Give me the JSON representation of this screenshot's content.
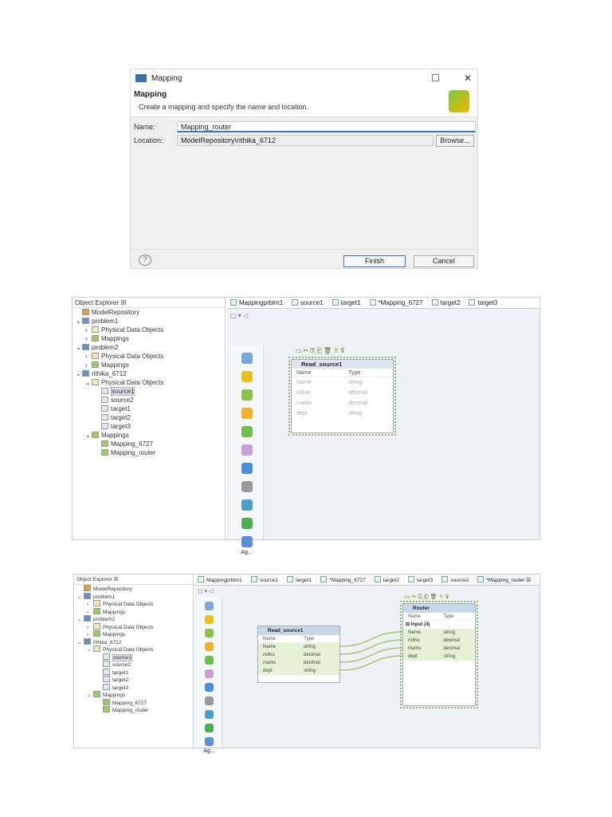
{
  "dialog": {
    "title": "Mapping",
    "heading": "Mapping",
    "description": "Create a mapping and specify the name and location.",
    "name_label": "Name:",
    "name_value": "Mapping_router",
    "location_label": "Location:",
    "location_value": "ModelRepository\\rithika_6712",
    "browse": "Browse...",
    "finish": "Finish",
    "cancel": "Cancel",
    "help_icon": "?",
    "maximize_icon": "☐",
    "close_icon": "✕"
  },
  "explorer": {
    "title": "Object Explorer ☒",
    "tree": [
      {
        "d": 0,
        "t": "ModelRepository",
        "i": "repo"
      },
      {
        "d": 0,
        "t": "problem1",
        "e": "v",
        "i": "project"
      },
      {
        "d": 1,
        "t": "Physical Data Objects",
        "e": ">",
        "i": "folder"
      },
      {
        "d": 1,
        "t": "Mappings",
        "e": ">",
        "i": "mapping"
      },
      {
        "d": 0,
        "t": "problem2",
        "e": "v",
        "i": "project"
      },
      {
        "d": 1,
        "t": "Physical Data Objects",
        "e": ">",
        "i": "folder"
      },
      {
        "d": 1,
        "t": "Mappings",
        "e": ">",
        "i": "mapping"
      },
      {
        "d": 0,
        "t": "rithika_6712",
        "e": "v",
        "i": "project"
      },
      {
        "d": 1,
        "t": "Physical Data Objects",
        "e": "v",
        "i": "folder"
      },
      {
        "d": 2,
        "t": "source1",
        "i": "object",
        "sel": true
      },
      {
        "d": 2,
        "t": "source2",
        "i": "object"
      },
      {
        "d": 2,
        "t": "target1",
        "i": "object"
      },
      {
        "d": 2,
        "t": "target2",
        "i": "object"
      },
      {
        "d": 2,
        "t": "target3",
        "i": "object"
      },
      {
        "d": 1,
        "t": "Mappings",
        "e": "v",
        "i": "mapping"
      },
      {
        "d": 2,
        "t": "Mapping_6727",
        "i": "mapping"
      },
      {
        "d": 2,
        "t": "Mapping_router",
        "i": "mapping"
      }
    ]
  },
  "tabs1": [
    "Mappingprblm1",
    "source1",
    "target1",
    "*Mapping_6727",
    "target2",
    "target3"
  ],
  "tabs2": [
    "Mappingprblm1",
    "source1",
    "target1",
    "*Mapping_6727",
    "target2",
    "target3",
    "source2",
    "*Mapping_router ☒"
  ],
  "palette": {
    "label": "Ag..."
  },
  "read_source": {
    "title": "Read_source1",
    "col_name": "Name",
    "col_type": "Type",
    "rows": [
      [
        "Name",
        "string"
      ],
      [
        "rollno",
        "decimal"
      ],
      [
        "marks",
        "decimal"
      ],
      [
        "dept",
        "string"
      ]
    ]
  },
  "router": {
    "title": "Router",
    "col_name": "Name",
    "col_type": "Type",
    "group": "⊟ Input (4)",
    "rows": [
      [
        "Name",
        "string"
      ],
      [
        "rollno",
        "decimal"
      ],
      [
        "marks",
        "decimal"
      ],
      [
        "dept",
        "string"
      ]
    ]
  },
  "colors": {
    "link": "#9ccc65",
    "header": "#c9d8e8",
    "highlight": "#e6f2d6"
  }
}
